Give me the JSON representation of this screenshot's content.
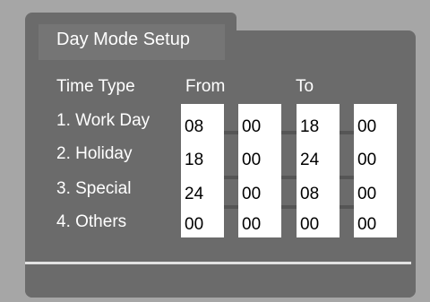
{
  "title": "Day Mode Setup",
  "headers": {
    "time_type": "Time Type",
    "from": "From",
    "to": "To"
  },
  "rows": [
    {
      "label": "1. Work Day",
      "from_hour": "08",
      "from_min": "00",
      "to_hour": "18",
      "to_min": "00"
    },
    {
      "label": "2. Holiday",
      "from_hour": "18",
      "from_min": "00",
      "to_hour": "24",
      "to_min": "00"
    },
    {
      "label": "3. Special",
      "from_hour": "24",
      "from_min": "00",
      "to_hour": "08",
      "to_min": "00"
    },
    {
      "label": "4. Others",
      "from_hour": "00",
      "from_min": "00",
      "to_hour": "00",
      "to_min": "00"
    }
  ]
}
